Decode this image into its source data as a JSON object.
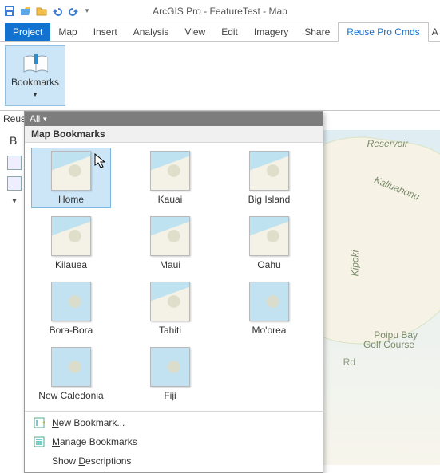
{
  "title": "ArcGIS Pro - FeatureTest - Map",
  "tabs": {
    "project": "Project",
    "map": "Map",
    "insert": "Insert",
    "analysis": "Analysis",
    "view": "View",
    "edit": "Edit",
    "imagery": "Imagery",
    "share": "Share",
    "reuse": "Reuse Pro Cmds",
    "trail": "A"
  },
  "ribbon": {
    "bookmarks_label": "Bookmarks"
  },
  "panel": {
    "reuse_short": "Reus",
    "be": "B"
  },
  "dropdown": {
    "all": "All",
    "heading": "Map Bookmarks",
    "items": [
      "Home",
      "Kauai",
      "Big Island",
      "Kilauea",
      "Maui",
      "Oahu",
      "Bora-Bora",
      "Tahiti",
      "Mo'orea",
      "New Caledonia",
      "Fiji"
    ],
    "new_bookmark": "New Bookmark...",
    "manage": "Manage Bookmarks",
    "show_desc": "Show Descriptions"
  },
  "maplabels": {
    "reservoir": "Reservoir",
    "kal": "Kaliuahonu",
    "kipoki": "Kipoki",
    "poipu1": "Poipu Bay",
    "poipu2": "Golf Course",
    "rd": "Rd"
  }
}
